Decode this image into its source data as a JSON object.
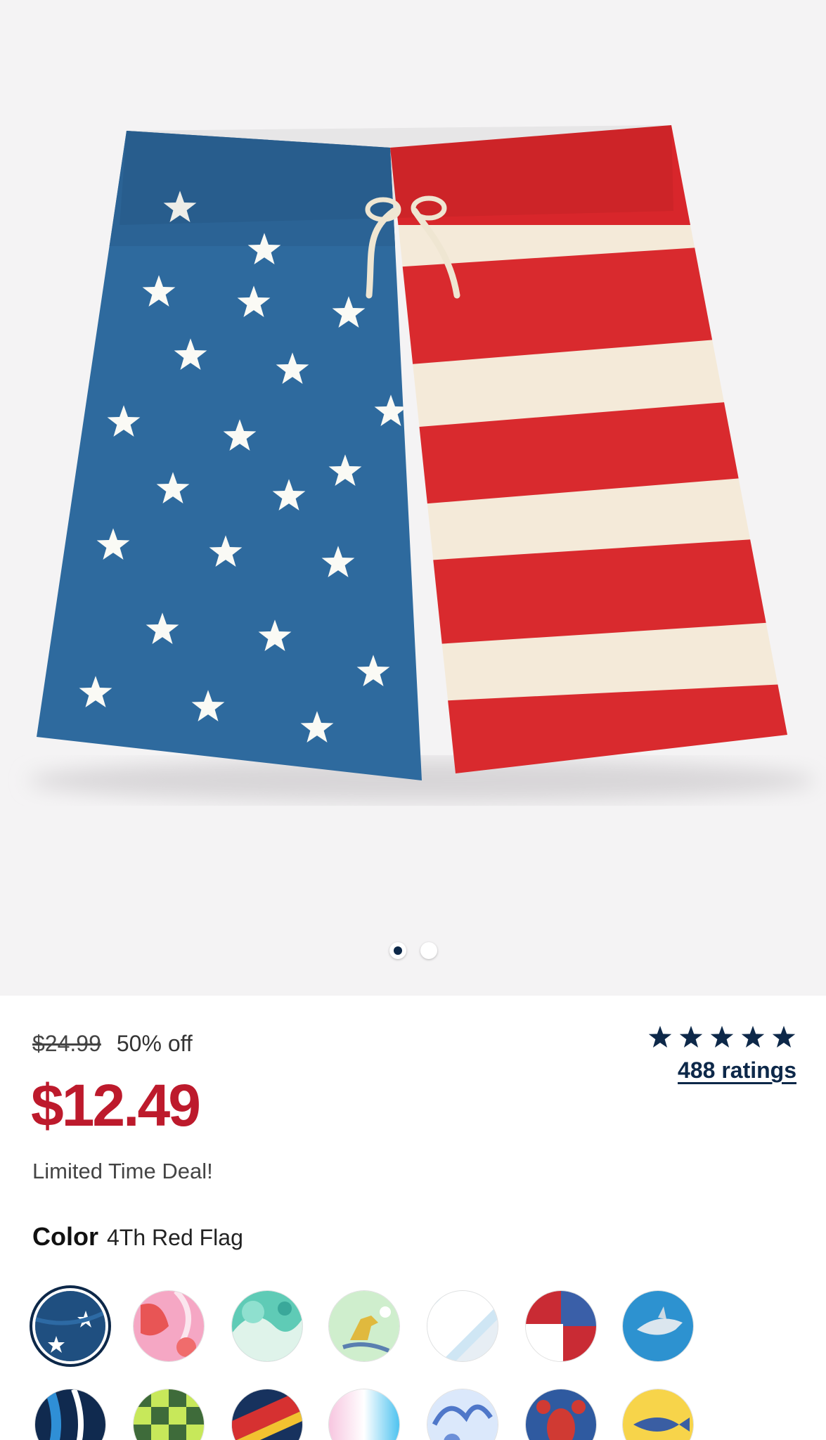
{
  "product": {
    "image_alt": "flag swim shorts",
    "carousel": {
      "total": 2,
      "active": 1
    }
  },
  "pricing": {
    "original_price": "$24.99",
    "discount": "50% off",
    "sale_price": "$12.49",
    "deal_text": "Limited Time Deal!"
  },
  "rating": {
    "stars": 5,
    "ratings_label": "488 ratings"
  },
  "color": {
    "label": "Color",
    "selected": "4Th Red Flag"
  },
  "swatches": [
    {
      "name": "4th-red-flag",
      "selected": true
    },
    {
      "name": "pink-floral"
    },
    {
      "name": "teal-tropical"
    },
    {
      "name": "dinosaur-surf"
    },
    {
      "name": "light-blue-stripe"
    },
    {
      "name": "red-white-blue-geo"
    },
    {
      "name": "shark"
    },
    {
      "name": "navy-wave"
    },
    {
      "name": "green-checker"
    },
    {
      "name": "navy-red-stripe"
    },
    {
      "name": "pastel-gradient"
    },
    {
      "name": "blue-floral"
    },
    {
      "name": "lobster"
    },
    {
      "name": "yellow-fish"
    }
  ],
  "colors": {
    "sale_red": "#bd1a2c",
    "navy": "#0d2849"
  }
}
